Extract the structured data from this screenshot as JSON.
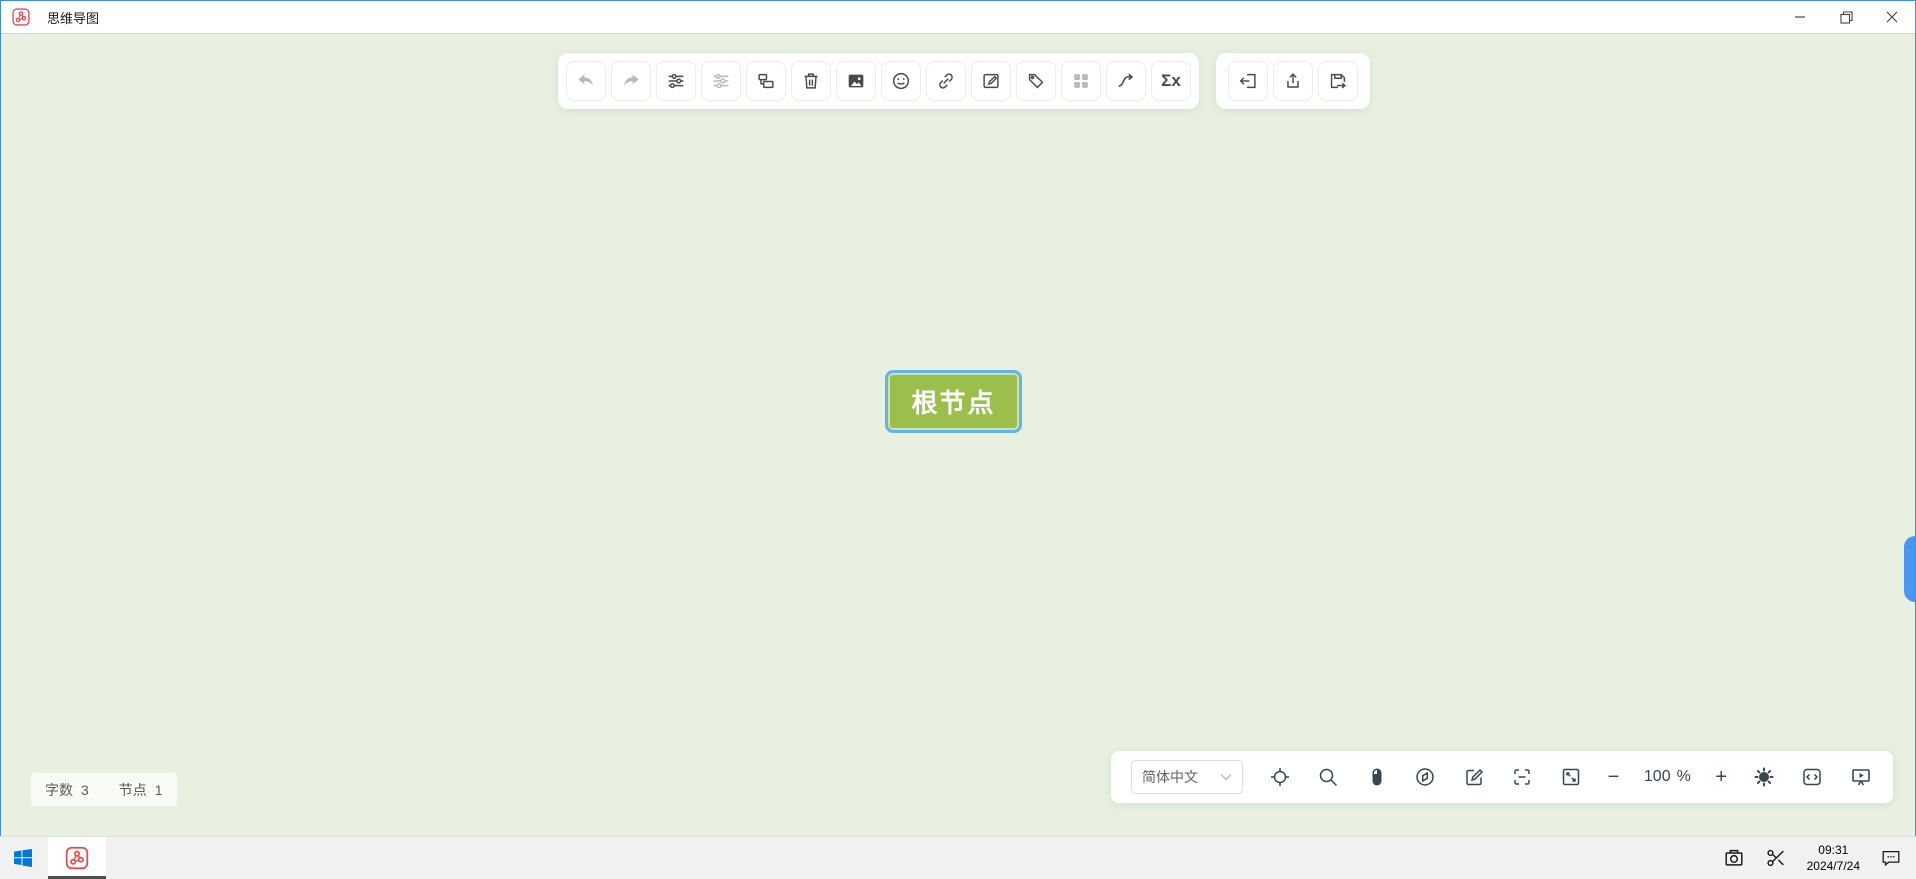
{
  "titlebar": {
    "title": "思维导图",
    "controls": [
      "minimize-icon",
      "restore-icon",
      "close-icon"
    ]
  },
  "main_toolbar": {
    "items": [
      "undo",
      "redo",
      "node-style",
      "canvas-style",
      "insert-node",
      "delete",
      "image",
      "emoji",
      "hyperlink",
      "note",
      "tag",
      "summary",
      "associative-line",
      "formula"
    ],
    "disabled_items": [
      "undo",
      "redo",
      "canvas-style",
      "summary"
    ],
    "formula_label": "Σx"
  },
  "io_toolbar": {
    "items": [
      "import",
      "export",
      "save"
    ]
  },
  "canvas": {
    "root_node": {
      "label": "根节点"
    }
  },
  "status_bar": {
    "word_count_label": "字数",
    "word_count": "3",
    "node_count_label": "节点",
    "node_count": "1"
  },
  "control_bar": {
    "language": "简体中文",
    "icons": [
      "locate",
      "search",
      "mouse-mode",
      "minimap",
      "edit-mode",
      "fit-canvas",
      "fullscreen",
      "zoom-out",
      "zoom-in",
      "theme",
      "source-code",
      "presentation"
    ],
    "zoom_out": "−",
    "zoom_value": "100",
    "percent_sign": "%",
    "zoom_in": "+"
  },
  "taskbar": {
    "time": "09:31",
    "date": "2024/7/24",
    "tray_icons": [
      "screenshot-camera",
      "snip-scissors",
      "chat-bubble"
    ]
  },
  "colors": {
    "canvas_bg": "#e8f1e0",
    "node_fill": "#9abf4b",
    "selection_blue": "#63b4e8",
    "app_red": "#e24c4c",
    "windows_blue": "#0078d6",
    "edge_handle_blue": "#4a96f2"
  }
}
